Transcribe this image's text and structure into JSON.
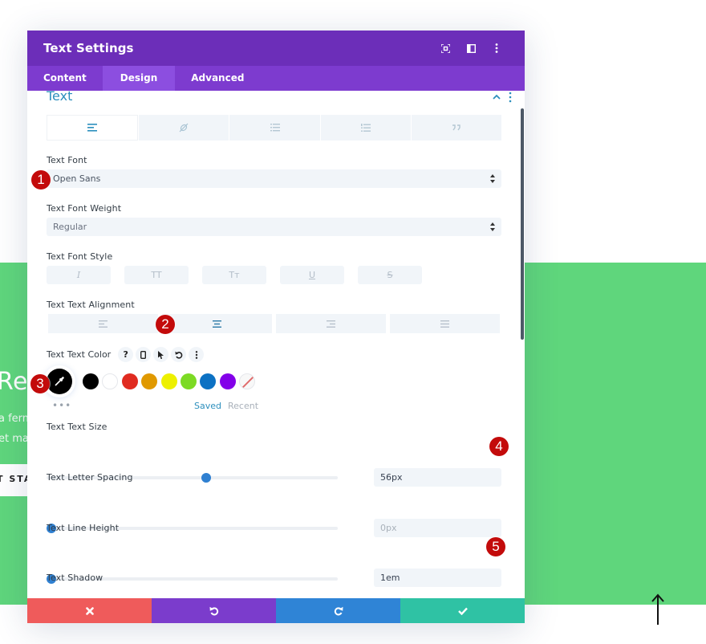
{
  "background": {
    "heading_fragment": "Re",
    "paragraph_line_1": "a ferm",
    "paragraph_line_2": "et ma",
    "button_fragment": "T STA",
    "green_color": "#5fd67c"
  },
  "modal": {
    "title": "Text Settings",
    "header_icons": [
      "fullscreen-icon",
      "split-view-icon",
      "more-vertical-icon"
    ],
    "tabs": [
      {
        "label": "Content",
        "active": false
      },
      {
        "label": "Design",
        "active": true
      },
      {
        "label": "Advanced",
        "active": false
      }
    ],
    "section_title": "Text",
    "text_type_tabs": [
      {
        "icon": "paragraph-align-icon",
        "active": true
      },
      {
        "icon": "link-icon",
        "active": false
      },
      {
        "icon": "unordered-list-icon",
        "active": false
      },
      {
        "icon": "ordered-list-icon",
        "active": false
      },
      {
        "icon": "blockquote-icon",
        "active": false
      }
    ],
    "fields": {
      "text_font": {
        "label": "Text Font",
        "value": "Open Sans"
      },
      "text_font_weight": {
        "label": "Text Font Weight",
        "value": "Regular"
      },
      "text_font_style": {
        "label": "Text Font Style",
        "options": [
          {
            "glyph": "I",
            "icon": "italic-icon"
          },
          {
            "glyph": "TT",
            "icon": "uppercase-icon"
          },
          {
            "glyph": "Tт",
            "icon": "smallcaps-icon"
          },
          {
            "glyph": "U",
            "icon": "underline-icon"
          },
          {
            "glyph": "S",
            "icon": "strikethrough-icon"
          }
        ]
      },
      "text_alignment": {
        "label": "Text Text Alignment",
        "options": [
          "left",
          "center",
          "right",
          "justify"
        ],
        "selected": "center"
      },
      "text_color": {
        "label": "Text Text Color",
        "current": "#000000",
        "swatches": [
          "#000000",
          "#ffffff",
          "#e02b20",
          "#e09900",
          "#edf000",
          "#7cda24",
          "#0c71c3",
          "#8300e9",
          "none"
        ],
        "saved_label": "Saved",
        "recent_label": "Recent",
        "more_label": "•••"
      },
      "text_size": {
        "label": "Text Text Size",
        "value": "56px",
        "slider_fraction": 0.55
      },
      "letter_spacing": {
        "label": "Text Letter Spacing",
        "placeholder": "0px",
        "slider_fraction": 0.0
      },
      "line_height": {
        "label": "Text Line Height",
        "value": "1em",
        "slider_fraction": 0.0
      },
      "text_shadow": {
        "label": "Text Shadow"
      }
    },
    "footer": {
      "cancel_color": "#ef5b5b",
      "undo_color": "#7b3ccc",
      "redo_color": "#2f84d6",
      "save_color": "#2fc2a4"
    }
  },
  "annotations": [
    "1",
    "2",
    "3",
    "4",
    "5"
  ],
  "colors": {
    "header": "#6c2eb9",
    "tabs": "#7d3bcf",
    "tab_active": "#8c4ee0",
    "accent_blue": "#2c8fbd",
    "slider_thumb": "#2f80d1",
    "badge": "#c30b0b"
  }
}
